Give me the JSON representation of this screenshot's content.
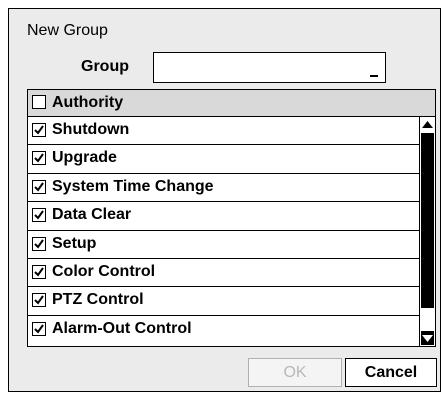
{
  "dialog": {
    "title": "New Group",
    "group_label": "Group",
    "group_value": "",
    "authority": {
      "header_label": "Authority",
      "header_checked": false,
      "items": [
        {
          "label": "Shutdown",
          "checked": true
        },
        {
          "label": "Upgrade",
          "checked": true
        },
        {
          "label": "System Time Change",
          "checked": true
        },
        {
          "label": "Data Clear",
          "checked": true
        },
        {
          "label": "Setup",
          "checked": true
        },
        {
          "label": "Color Control",
          "checked": true
        },
        {
          "label": "PTZ Control",
          "checked": true
        },
        {
          "label": "Alarm-Out Control",
          "checked": true
        }
      ]
    },
    "buttons": {
      "ok_label": "OK",
      "ok_enabled": false,
      "cancel_label": "Cancel"
    }
  }
}
